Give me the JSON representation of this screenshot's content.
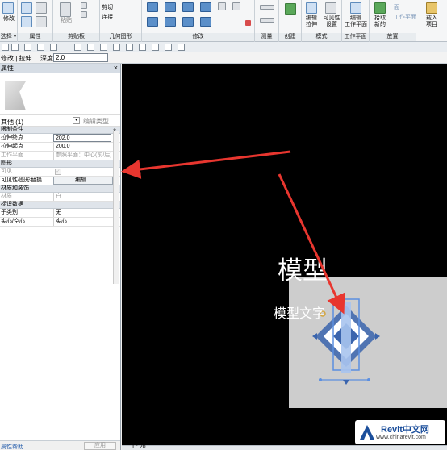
{
  "ribbon": {
    "groups": [
      {
        "label": "选择",
        "dropdown": true
      },
      {
        "label": "属性",
        "dropdown": false
      },
      {
        "label": "剪贴板",
        "dropdown": false
      },
      {
        "label": "几何图形",
        "dropdown": false
      },
      {
        "label": "修改",
        "dropdown": false
      },
      {
        "label": "测量",
        "dropdown": false
      },
      {
        "label": "创建",
        "dropdown": false
      },
      {
        "label": "模式",
        "dropdown": false
      },
      {
        "label": "工作平面",
        "dropdown": false
      },
      {
        "label": "放置",
        "dropdown": false
      }
    ],
    "modify_label": "修改",
    "paste_label": "粘贴",
    "cut_label": "剪切",
    "join_label": "连接",
    "edit_extrusion": "编辑\n拉伸",
    "visibility_settings": "可见性\n设置",
    "edit_workplane": "编辑\n工作平面",
    "pick_new": "拾取\n新的",
    "workplane_label": "工作平面",
    "place_top": "面",
    "place_item": "载入\n项目"
  },
  "options_bar": {
    "context": "修改 | 拉伸",
    "depth_label": "深度",
    "depth_value": "2.0"
  },
  "properties": {
    "title": "属性",
    "close_glyph": "×",
    "type_selector": "其他 (1)",
    "edit_type": "编辑类型",
    "sections": {
      "constraints": "限制条件",
      "graphics": "图形",
      "materials": "材质和装饰",
      "identity": "标识数据"
    },
    "rows": {
      "extrusion_end_label": "拉伸终点",
      "extrusion_end_value": "202.0",
      "extrusion_start_label": "拉伸起点",
      "extrusion_start_value": "200.0",
      "workplane_label": "工作平面",
      "workplane_value": "参照平面：中心(前/后)",
      "visible_label": "可见",
      "vis_override_label": "可见性/图形替换",
      "vis_override_button": "编辑...",
      "material_label": "材质",
      "material_value": "白",
      "subcategory_label": "子类别",
      "subcategory_value": "无",
      "solid_void_label": "实心/空心",
      "solid_void_value": "实心"
    },
    "help_link": "属性帮助",
    "apply_button": "应用"
  },
  "canvas": {
    "model_text_big": "模型",
    "model_text_small": "模型文字"
  },
  "status_bar": {
    "scale": "1 : 20"
  },
  "watermark": {
    "title": "Revit中文网",
    "url": "www.chinarevit.com"
  },
  "colors": {
    "canvas_bg": "#000000",
    "annotation_arrow": "#e8362f",
    "selection_blue": "#4a7fcf"
  }
}
